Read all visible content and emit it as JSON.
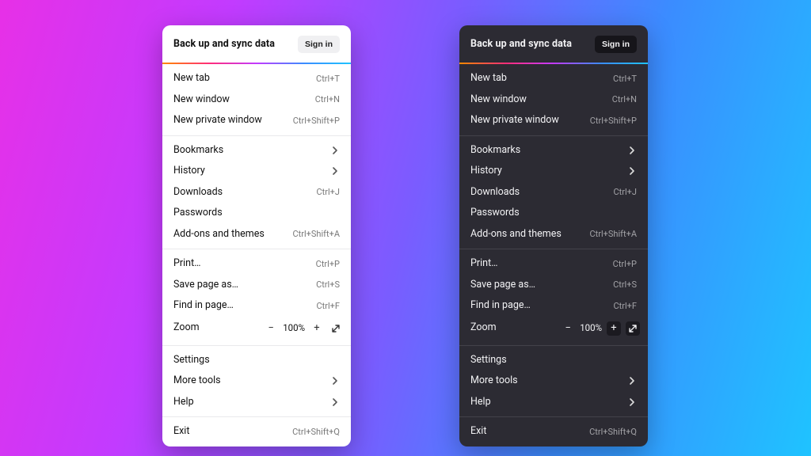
{
  "header": {
    "title": "Back up and sync data",
    "signin": "Sign in"
  },
  "groups": [
    [
      {
        "label": "New tab",
        "shortcut": "Ctrl+T"
      },
      {
        "label": "New window",
        "shortcut": "Ctrl+N"
      },
      {
        "label": "New private window",
        "shortcut": "Ctrl+Shift+P"
      }
    ],
    [
      {
        "label": "Bookmarks",
        "submenu": true
      },
      {
        "label": "History",
        "submenu": true
      },
      {
        "label": "Downloads",
        "shortcut": "Ctrl+J"
      },
      {
        "label": "Passwords"
      },
      {
        "label": "Add-ons and themes",
        "shortcut": "Ctrl+Shift+A"
      }
    ],
    [
      {
        "label": "Print…",
        "shortcut": "Ctrl+P"
      },
      {
        "label": "Save page as…",
        "shortcut": "Ctrl+S"
      },
      {
        "label": "Find in page…",
        "shortcut": "Ctrl+F"
      }
    ],
    [
      {
        "label": "Settings"
      },
      {
        "label": "More tools",
        "submenu": true
      },
      {
        "label": "Help",
        "submenu": true
      }
    ],
    [
      {
        "label": "Exit",
        "shortcut": "Ctrl+Shift+Q"
      }
    ]
  ],
  "zoom": {
    "label": "Zoom",
    "level": "100%"
  }
}
